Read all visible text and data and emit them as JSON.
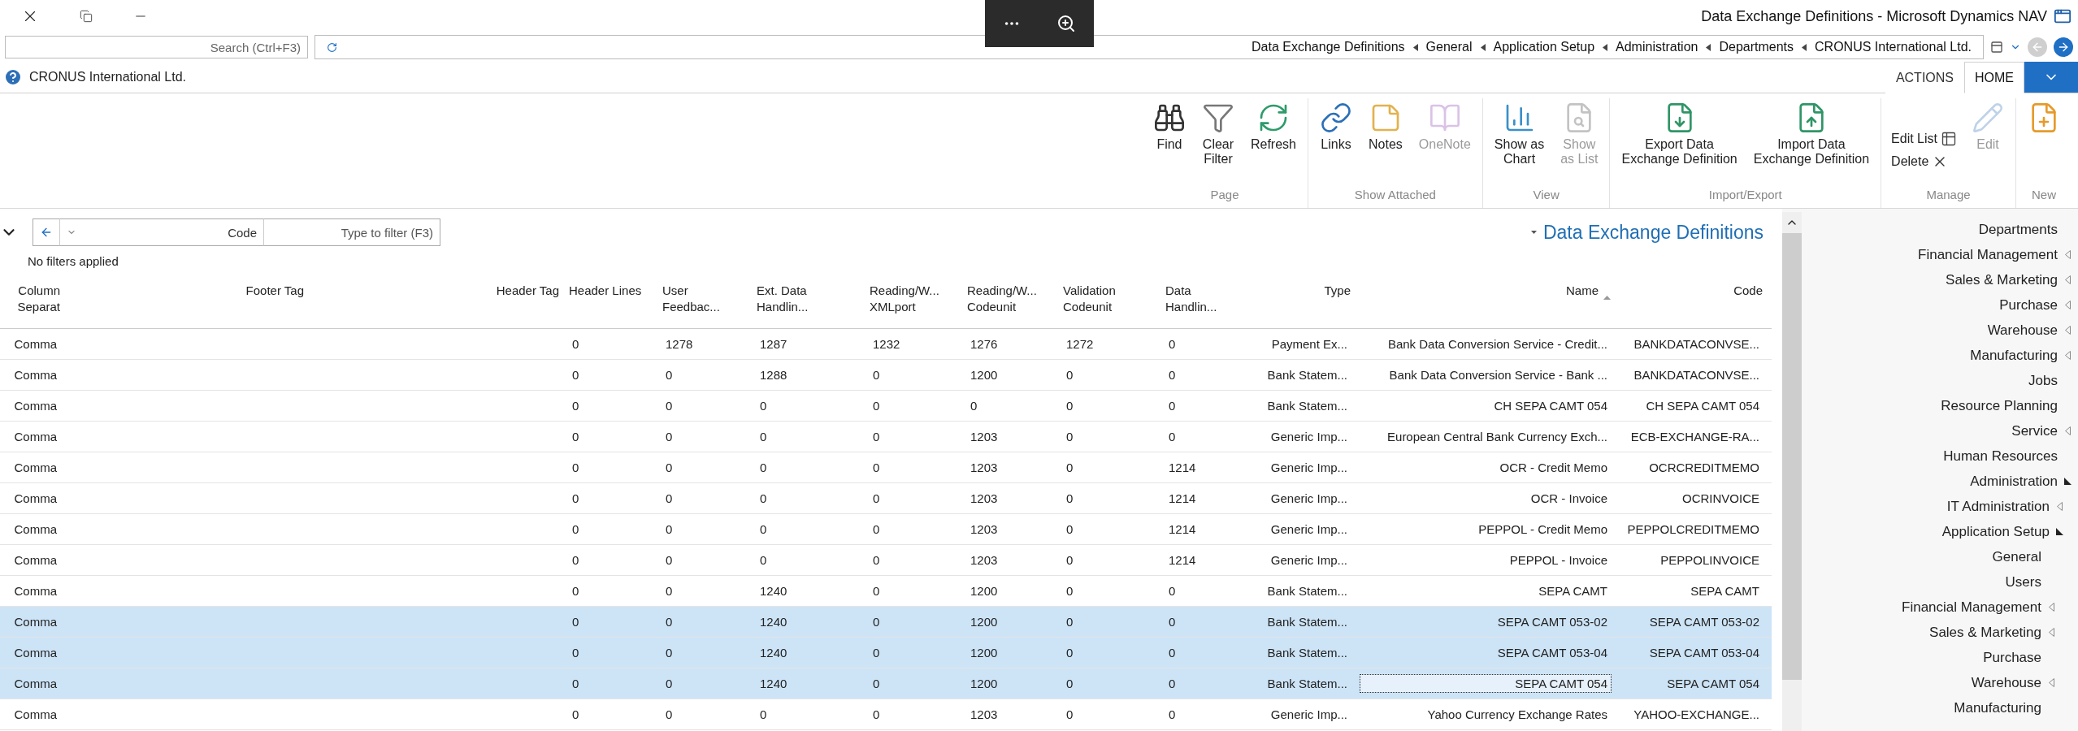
{
  "window": {
    "title": "Data Exchange Definitions - Microsoft Dynamics NAV"
  },
  "address_bar": {
    "search": {
      "placeholder": "Search (Ctrl+F3)"
    },
    "breadcrumb": [
      "Data Exchange Definitions",
      "General",
      "Application Setup",
      "Administration",
      "Departments",
      "CRONUS International Ltd."
    ]
  },
  "company": "CRONUS International Ltd.",
  "ribbon_tabs": [
    {
      "label": "ACTIONS",
      "selected": false
    },
    {
      "label": "HOME",
      "selected": true
    }
  ],
  "ribbon_groups": [
    {
      "label": "Page",
      "buttons": [
        {
          "label": "Find",
          "kind": "large",
          "disabled": false
        },
        {
          "label": "Clear\nFilter",
          "kind": "large",
          "disabled": false
        },
        {
          "label": "Refresh",
          "kind": "large",
          "disabled": false
        }
      ]
    },
    {
      "label": "Show Attached",
      "buttons": [
        {
          "label": "Links",
          "kind": "large",
          "disabled": false
        },
        {
          "label": "Notes",
          "kind": "large",
          "disabled": false
        },
        {
          "label": "OneNote",
          "kind": "large",
          "disabled": true
        }
      ]
    },
    {
      "label": "View",
      "buttons": [
        {
          "label": "Show as\nChart",
          "kind": "large",
          "disabled": false
        },
        {
          "label": "Show\nas List",
          "kind": "large",
          "disabled": true
        }
      ]
    },
    {
      "label": "Import/Export",
      "buttons": [
        {
          "label": "Export Data\nExchange Definition",
          "kind": "large",
          "disabled": false
        },
        {
          "label": "Import Data\nExchange Definition",
          "kind": "large",
          "disabled": false
        }
      ]
    },
    {
      "label": "Manage",
      "buttons": [
        {
          "label": "Edit List",
          "kind": "small",
          "disabled": false
        },
        {
          "label": "Delete",
          "kind": "small",
          "disabled": false
        },
        {
          "label": "Edit",
          "kind": "large",
          "disabled": true
        }
      ]
    },
    {
      "label": "New",
      "buttons": [
        {
          "kind": "large",
          "disabled": false
        }
      ]
    }
  ],
  "page": {
    "filter": {
      "field": "Code",
      "placeholder": "Type to filter (F3)"
    },
    "title": "Data Exchange Definitions",
    "filter_status": "No filters applied"
  },
  "table": {
    "columns": [
      {
        "label": "Column Separat",
        "kind": "text",
        "sorted": false
      },
      {
        "label": "Footer Tag",
        "kind": "text",
        "sorted": false
      },
      {
        "label": "Header Tag",
        "kind": "text",
        "sorted": false
      },
      {
        "label": "Header Lines",
        "kind": "number",
        "sorted": false
      },
      {
        "label": "User Feedbac...",
        "kind": "number",
        "sorted": false
      },
      {
        "label": "Ext. Data Handlin...",
        "kind": "number",
        "sorted": false
      },
      {
        "label": "Reading/W... XMLport",
        "kind": "number",
        "sorted": false
      },
      {
        "label": "Reading/W... Codeunit",
        "kind": "number",
        "sorted": false
      },
      {
        "label": "Validation Codeunit",
        "kind": "number",
        "sorted": false
      },
      {
        "label": "Data Handlin...",
        "kind": "number",
        "sorted": false
      },
      {
        "label": "Type",
        "kind": "text",
        "sorted": false
      },
      {
        "label": "Name",
        "kind": "text",
        "sorted": true
      },
      {
        "label": "Code",
        "kind": "text",
        "sorted": false
      }
    ],
    "rows": [
      {
        "selected": false,
        "cells": [
          "Comma",
          "",
          "",
          "0",
          "1278",
          "1287",
          "1232",
          "1276",
          "1272",
          "0",
          "Payment Ex...",
          "Bank Data Conversion Service - Credit...",
          "BANKDATACONVSE..."
        ]
      },
      {
        "selected": false,
        "cells": [
          "Comma",
          "",
          "",
          "0",
          "0",
          "1288",
          "0",
          "1200",
          "0",
          "0",
          "Bank Statem...",
          "Bank Data Conversion Service - Bank ...",
          "BANKDATACONVSE..."
        ]
      },
      {
        "selected": false,
        "cells": [
          "Comma",
          "",
          "",
          "0",
          "0",
          "0",
          "0",
          "0",
          "0",
          "0",
          "Bank Statem...",
          "CH SEPA CAMT 054",
          "CH SEPA CAMT 054"
        ]
      },
      {
        "selected": false,
        "cells": [
          "Comma",
          "",
          "",
          "0",
          "0",
          "0",
          "0",
          "1203",
          "0",
          "0",
          "Generic Imp...",
          "European Central Bank Currency Exch...",
          "ECB-EXCHANGE-RA..."
        ]
      },
      {
        "selected": false,
        "cells": [
          "Comma",
          "",
          "",
          "0",
          "0",
          "0",
          "0",
          "1203",
          "0",
          "1214",
          "Generic Imp...",
          "OCR - Credit Memo",
          "OCRCREDITMEMO"
        ]
      },
      {
        "selected": false,
        "cells": [
          "Comma",
          "",
          "",
          "0",
          "0",
          "0",
          "0",
          "1203",
          "0",
          "1214",
          "Generic Imp...",
          "OCR - Invoice",
          "OCRINVOICE"
        ]
      },
      {
        "selected": false,
        "cells": [
          "Comma",
          "",
          "",
          "0",
          "0",
          "0",
          "0",
          "1203",
          "0",
          "1214",
          "Generic Imp...",
          "PEPPOL - Credit Memo",
          "PEPPOLCREDITMEMO"
        ]
      },
      {
        "selected": false,
        "cells": [
          "Comma",
          "",
          "",
          "0",
          "0",
          "0",
          "0",
          "1203",
          "0",
          "1214",
          "Generic Imp...",
          "PEPPOL - Invoice",
          "PEPPOLINVOICE"
        ]
      },
      {
        "selected": false,
        "cells": [
          "Comma",
          "",
          "",
          "0",
          "0",
          "1240",
          "0",
          "1200",
          "0",
          "0",
          "Bank Statem...",
          "SEPA CAMT",
          "SEPA CAMT"
        ]
      },
      {
        "selected": true,
        "cells": [
          "Comma",
          "",
          "",
          "0",
          "0",
          "1240",
          "0",
          "1200",
          "0",
          "0",
          "Bank Statem...",
          "SEPA CAMT 053-02",
          "SEPA CAMT 053-02"
        ]
      },
      {
        "selected": true,
        "cells": [
          "Comma",
          "",
          "",
          "0",
          "0",
          "1240",
          "0",
          "1200",
          "0",
          "0",
          "Bank Statem...",
          "SEPA CAMT 053-04",
          "SEPA CAMT 053-04"
        ]
      },
      {
        "selected": true,
        "cells": [
          "Comma",
          "",
          "",
          "0",
          "0",
          "1240",
          "0",
          "1200",
          "0",
          "0",
          "Bank Statem...",
          {
            "text": "SEPA CAMT 054",
            "focused": true
          },
          "SEPA CAMT 054"
        ]
      },
      {
        "selected": false,
        "cells": [
          "Comma",
          "",
          "",
          "0",
          "0",
          "0",
          "0",
          "1203",
          "0",
          "0",
          "Generic Imp...",
          "Yahoo Currency Exchange Rates",
          "YAHOO-EXCHANGE..."
        ]
      }
    ]
  },
  "sidebar": {
    "items": [
      {
        "label": "Departments"
      },
      {
        "label": "Financial Management",
        "expanded": false
      },
      {
        "label": "Sales & Marketing",
        "expanded": false
      },
      {
        "label": "Purchase",
        "expanded": false
      },
      {
        "label": "Warehouse",
        "expanded": false
      },
      {
        "label": "Manufacturing",
        "expanded": false
      },
      {
        "label": "Jobs"
      },
      {
        "label": "Resource Planning"
      },
      {
        "label": "Service",
        "expanded": false
      },
      {
        "label": "Human Resources"
      },
      {
        "label": "Administration",
        "expanded": true,
        "children": [
          {
            "label": "IT Administration",
            "expanded": false
          },
          {
            "label": "Application Setup",
            "expanded": true,
            "children": [
              {
                "label": "General"
              },
              {
                "label": "Users"
              },
              {
                "label": "Financial Management",
                "expanded": false
              },
              {
                "label": "Sales & Marketing",
                "expanded": false
              },
              {
                "label": "Purchase"
              },
              {
                "label": "Warehouse",
                "expanded": false
              },
              {
                "label": "Manufacturing"
              }
            ]
          }
        ]
      }
    ]
  }
}
